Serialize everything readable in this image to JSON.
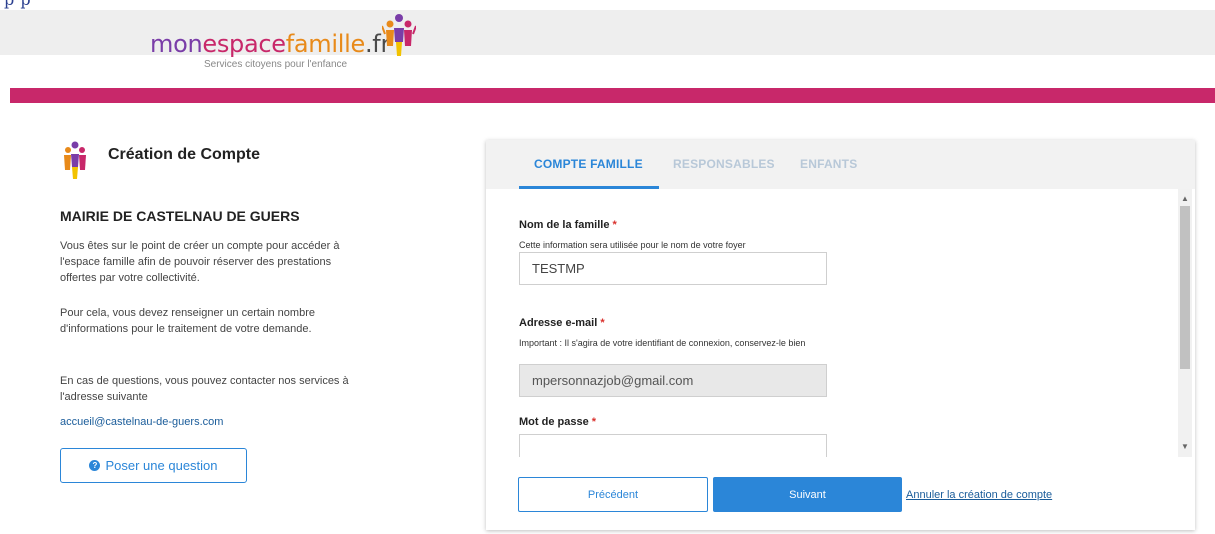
{
  "header": {
    "top_fragment": "p                                                          p",
    "logo": {
      "part1": "mon",
      "part2": "espace",
      "part3": "famille",
      "part4": ".fr"
    },
    "tagline": "Services citoyens pour l'enfance",
    "colors": {
      "brand_pink": "#c8286a",
      "brand_purple": "#7a3da8",
      "brand_orange": "#e88a1a"
    }
  },
  "left_panel": {
    "title": "Création de Compte",
    "organization": "MAIRIE DE CASTELNAU DE GUERS",
    "paragraph1": "Vous êtes sur le point de créer un compte pour accéder à l'espace famille afin de pouvoir réserver des prestations offertes par votre collectivité.",
    "paragraph2": "Pour cela, vous devez renseigner un certain nombre d'informations pour le traitement de votre demande.",
    "paragraph3": "En cas de questions, vous pouvez contacter nos services à l'adresse suivante",
    "contact_email": "accueil@castelnau-de-guers.com",
    "ask_button": "Poser une question",
    "ask_icon": "question-circle-icon"
  },
  "tabs": [
    {
      "label": "COMPTE FAMILLE",
      "active": true
    },
    {
      "label": "RESPONSABLES",
      "active": false
    },
    {
      "label": "ENFANTS",
      "active": false
    }
  ],
  "form": {
    "family_name": {
      "label": "Nom de la famille",
      "required_mark": "*",
      "help": "Cette information sera utilisée pour le nom de votre foyer",
      "value": "TESTMP"
    },
    "email": {
      "label": "Adresse e-mail",
      "required_mark": "*",
      "help": "Important : Il s'agira de votre identifiant de connexion, conservez-le bien",
      "value": "mpersonnazjob@gmail.com"
    },
    "password": {
      "label": "Mot de passe",
      "required_mark": "*",
      "value": ""
    }
  },
  "actions": {
    "previous": "Précédent",
    "next": "Suivant",
    "cancel": "Annuler la création de compte"
  },
  "accent_color": "#2b86d8"
}
